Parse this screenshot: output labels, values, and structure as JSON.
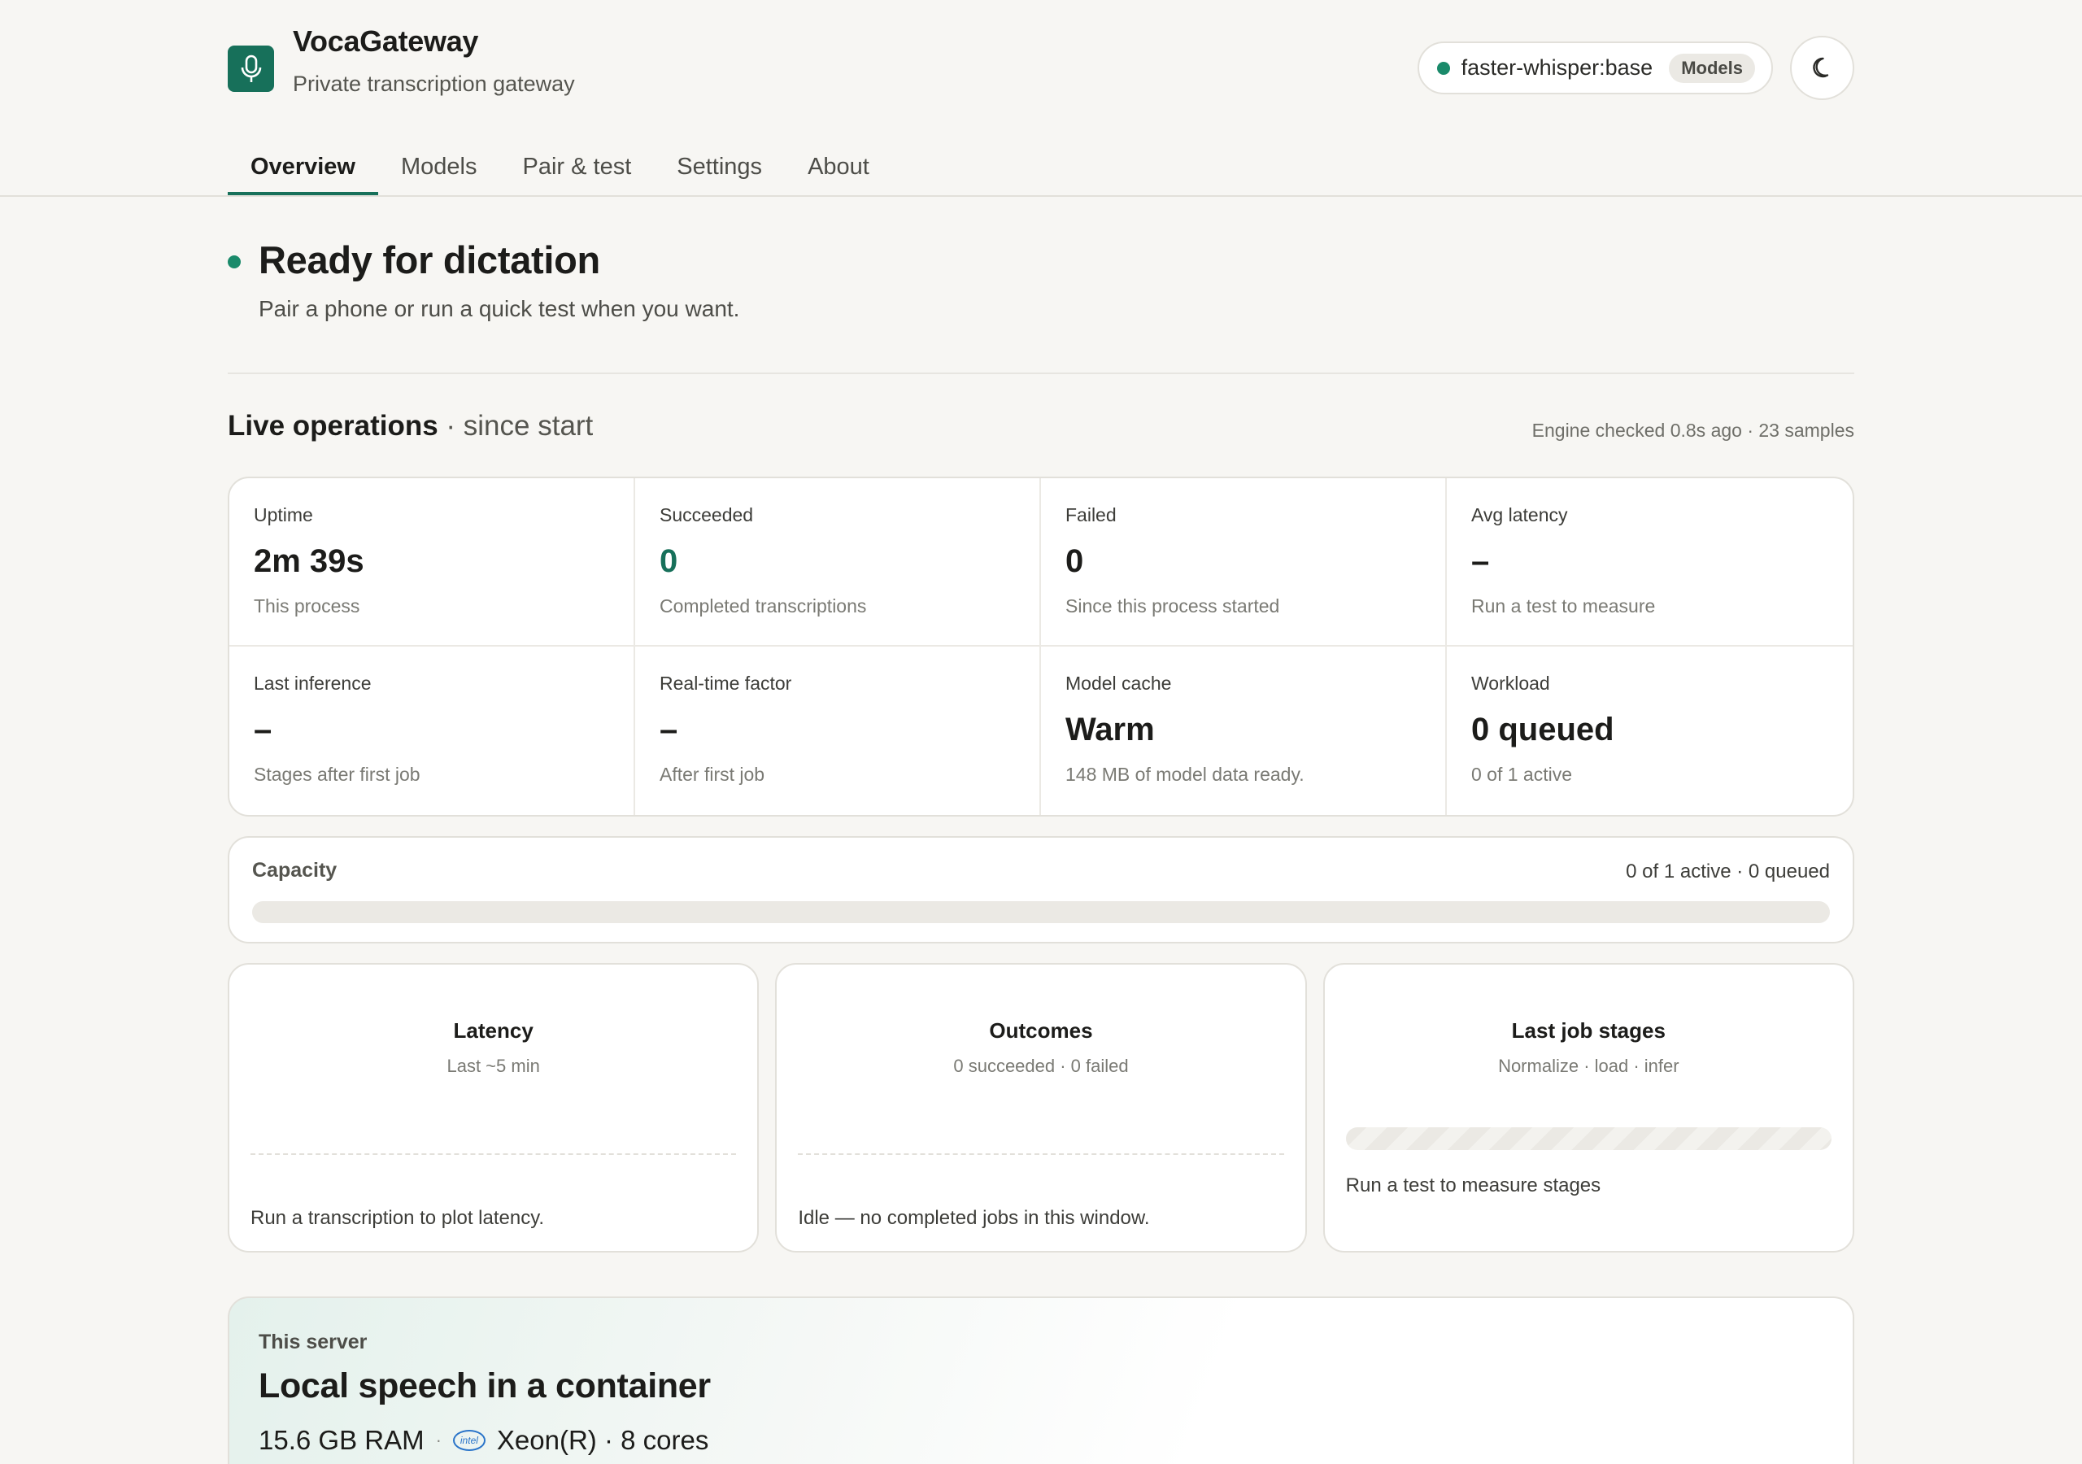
{
  "app": {
    "title": "VocaGateway",
    "subtitle": "Private transcription gateway",
    "model_name": "faster-whisper:base",
    "models_badge": "Models",
    "icons": {
      "logo": "microphone-icon",
      "theme": "moon-icon"
    },
    "colors": {
      "accent": "#17705a",
      "status_ok": "#1a8a6a"
    }
  },
  "tabs": [
    {
      "label": "Overview",
      "active": true
    },
    {
      "label": "Models",
      "active": false
    },
    {
      "label": "Pair & test",
      "active": false
    },
    {
      "label": "Settings",
      "active": false
    },
    {
      "label": "About",
      "active": false
    }
  ],
  "hero": {
    "title": "Ready for dictation",
    "subtitle": "Pair a phone or run a quick test when you want."
  },
  "operations": {
    "title": "Live operations",
    "since": "· since start",
    "meta": "Engine checked 0.8s ago · 23 samples",
    "stats": [
      {
        "label": "Uptime",
        "value": "2m 39s",
        "note": "This process"
      },
      {
        "label": "Succeeded",
        "value": "0",
        "note": "Completed transcriptions"
      },
      {
        "label": "Failed",
        "value": "0",
        "note": "Since this process started"
      },
      {
        "label": "Avg latency",
        "value": "–",
        "note": "Run a test to measure"
      },
      {
        "label": "Last inference",
        "value": "–",
        "note": "Stages after first job"
      },
      {
        "label": "Real-time factor",
        "value": "–",
        "note": "After first job"
      },
      {
        "label": "Model cache",
        "value": "Warm",
        "note": "148 MB of model data ready."
      },
      {
        "label": "Workload",
        "value": "0 queued",
        "note": "0 of 1 active"
      }
    ]
  },
  "capacity": {
    "label": "Capacity",
    "meta": "0 of 1 active · 0 queued",
    "fill_fraction": 0
  },
  "cards": {
    "latency": {
      "title": "Latency",
      "subtitle": "Last ~5 min",
      "note": "Run a transcription to plot latency."
    },
    "outcomes": {
      "title": "Outcomes",
      "subtitle": "0 succeeded · 0 failed",
      "note": "Idle — no completed jobs in this window."
    },
    "stages": {
      "title": "Last job stages",
      "subtitle": "Normalize · load · infer",
      "note": "Run a test to measure stages"
    }
  },
  "server": {
    "eyebrow": "This server",
    "title": "Local speech in a container",
    "ram": "15.6 GB RAM",
    "separator": "·",
    "cpu": "Xeon(R) · 8 cores",
    "cpu_vendor_logo": "intel"
  }
}
